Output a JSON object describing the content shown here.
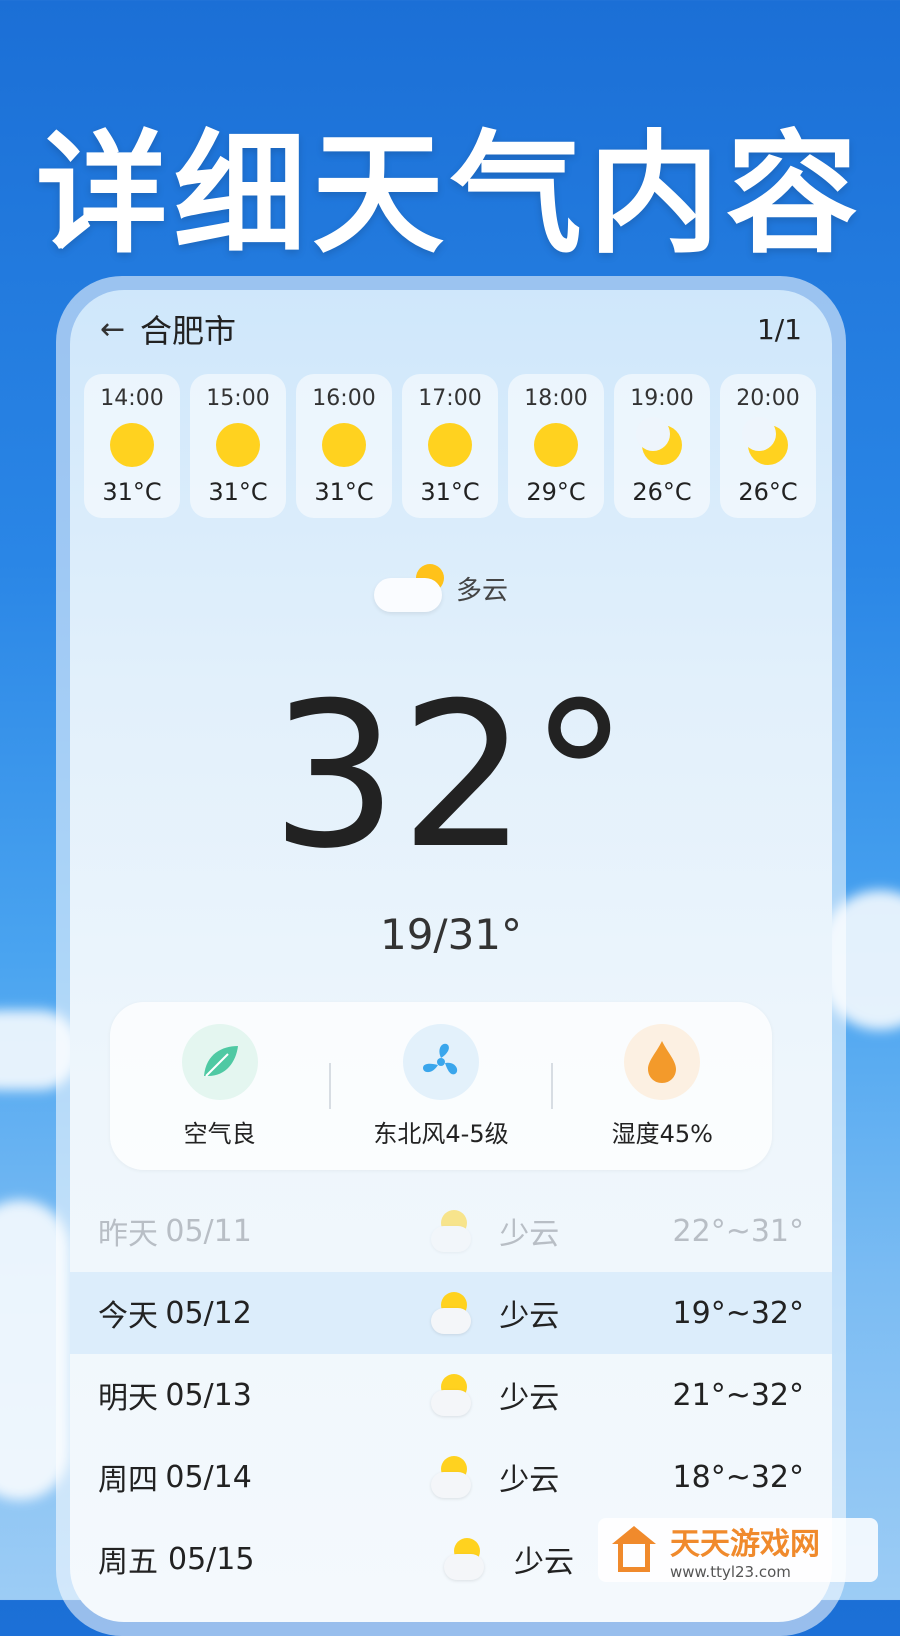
{
  "promo": {
    "title": "详细天气内容"
  },
  "header": {
    "back_icon": "back-arrow-icon",
    "city": "合肥市",
    "page_indicator": "1/1"
  },
  "hourly": [
    {
      "time": "14:00",
      "icon": "sun-icon",
      "temp": "31°C"
    },
    {
      "time": "15:00",
      "icon": "sun-icon",
      "temp": "31°C"
    },
    {
      "time": "16:00",
      "icon": "sun-icon",
      "temp": "31°C"
    },
    {
      "time": "17:00",
      "icon": "sun-icon",
      "temp": "31°C"
    },
    {
      "time": "18:00",
      "icon": "sun-icon",
      "temp": "29°C"
    },
    {
      "time": "19:00",
      "icon": "moon-icon",
      "temp": "26°C"
    },
    {
      "time": "20:00",
      "icon": "moon-icon",
      "temp": "26°C"
    }
  ],
  "current": {
    "condition": "多云",
    "condition_icon": "partly-cloudy-icon",
    "temp": "32°",
    "range": "19/31°"
  },
  "stats": [
    {
      "icon": "leaf-icon",
      "label": "空气良",
      "color": "#4fc9a3"
    },
    {
      "icon": "fan-icon",
      "label": "东北风4-5级",
      "color": "#3aa6ec"
    },
    {
      "icon": "drop-icon",
      "label": "湿度45%",
      "color": "#f39a2b"
    }
  ],
  "daily": [
    {
      "day": "昨天",
      "date": "05/11",
      "cond": "少云",
      "range": "22°~31°",
      "state": "past"
    },
    {
      "day": "今天",
      "date": "05/12",
      "cond": "少云",
      "range": "19°~32°",
      "state": "today"
    },
    {
      "day": "明天",
      "date": "05/13",
      "cond": "少云",
      "range": "21°~32°",
      "state": ""
    },
    {
      "day": "周四",
      "date": "05/14",
      "cond": "少云",
      "range": "18°~32°",
      "state": ""
    },
    {
      "day": "周五",
      "date": "05/15",
      "cond": "少云",
      "range": "",
      "state": ""
    }
  ],
  "watermark": {
    "name": "天天游戏网",
    "url": "www.ttyl23.com"
  }
}
